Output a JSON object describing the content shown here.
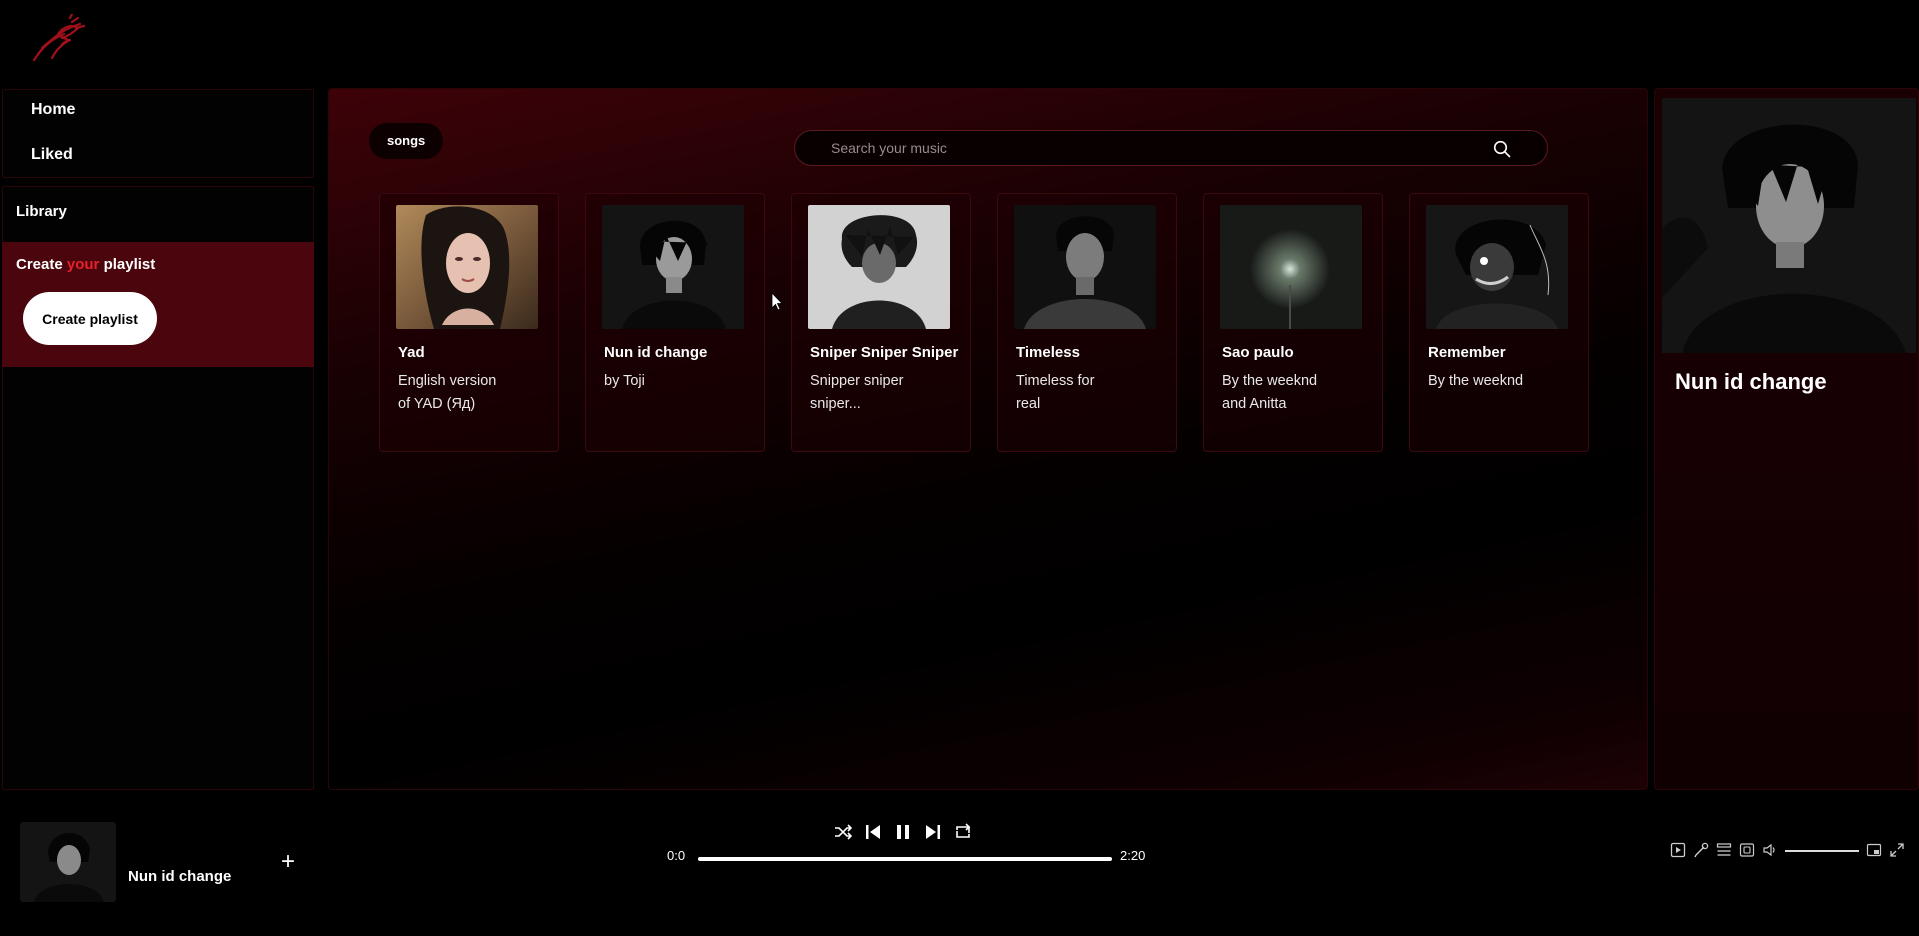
{
  "nav": {
    "home": "Home",
    "liked": "Liked"
  },
  "library": {
    "title": "Library",
    "create_prefix": "Create",
    "create_accent": "your",
    "create_suffix": "playlist",
    "create_button": "Create playlist"
  },
  "main": {
    "chip": "songs",
    "search_placeholder": "Search your music",
    "cards": [
      {
        "title": "Yad",
        "subtitle": "English version of YAD (Яд)"
      },
      {
        "title": "Nun id change",
        "subtitle": "by Toji"
      },
      {
        "title": "Sniper Sniper Sniper",
        "subtitle": "Snipper sniper sniper..."
      },
      {
        "title": "Timeless",
        "subtitle": "Timeless for real"
      },
      {
        "title": "Sao paulo",
        "subtitle": "By the weeknd and Anitta"
      },
      {
        "title": "Remember",
        "subtitle": "By the weeknd"
      }
    ]
  },
  "now_playing_panel": {
    "title": "Nun id change"
  },
  "player": {
    "title": "Nun id change",
    "add_label": "+",
    "time_current": "0:0",
    "time_total": "2:20",
    "progress": 0.0,
    "volume": 1.0
  },
  "icons": {
    "logo": "bird-logo-icon",
    "search": "search-icon",
    "shuffle": "shuffle-icon",
    "previous": "skip-previous-icon",
    "pause": "pause-icon",
    "next": "skip-next-icon",
    "repeat": "repeat-icon"
  },
  "colors": {
    "accent": "#e8202c",
    "library_box": "#4a060c",
    "background": "#000000"
  }
}
